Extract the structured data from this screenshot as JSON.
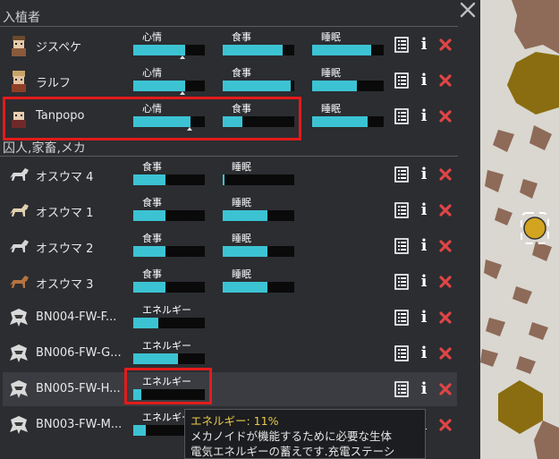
{
  "sections": {
    "colonists": "入植者",
    "prisoners": "囚人,家畜,メカ"
  },
  "need_labels": {
    "mood": "心情",
    "food": "食事",
    "rest": "睡眠",
    "energy": "エネルギー"
  },
  "colonists": [
    {
      "name": "ジスペケ",
      "mood": 0.72,
      "food": 0.84,
      "rest": 0.82
    },
    {
      "name": "ラルフ",
      "mood": 0.72,
      "food": 0.95,
      "rest": 0.62
    },
    {
      "name": "Tanpopo",
      "mood": 0.8,
      "food": 0.27,
      "rest": 0.77
    }
  ],
  "animals": [
    {
      "name": "オスウマ 4",
      "food": 0.45,
      "rest": 0.02
    },
    {
      "name": "オスウマ 1",
      "food": 0.45,
      "rest": 0.62
    },
    {
      "name": "オスウマ 2",
      "food": 0.45,
      "rest": 0.62
    },
    {
      "name": "オスウマ 3",
      "food": 0.45,
      "rest": 0.62
    }
  ],
  "mechs": [
    {
      "name": "BN004-FW-F...",
      "energy": 0.35
    },
    {
      "name": "BN006-FW-G...",
      "energy": 0.62
    },
    {
      "name": "BN005-FW-H...",
      "energy": 0.11
    },
    {
      "name": "BN003-FW-M...",
      "energy": 0.17
    }
  ],
  "tooltip": {
    "title": "エネルギー: 11%",
    "line1": "メカノイドが機能するために必要な生体",
    "line2": "電気エネルギーの蓄えです.充電ステーシ"
  },
  "colors": {
    "bar_fill": "#3cc3d3",
    "bar_bg": "#0a0a0a",
    "highlight_box": "#e31b1b",
    "delete_x": "#e04444",
    "map_hex": "#8a6d10",
    "map_rock": "#8e6a58",
    "map_pawn": "#d2a41f"
  },
  "icons": {
    "close": "close-icon",
    "log": "log-icon",
    "info": "info-icon",
    "delete": "delete-icon"
  }
}
